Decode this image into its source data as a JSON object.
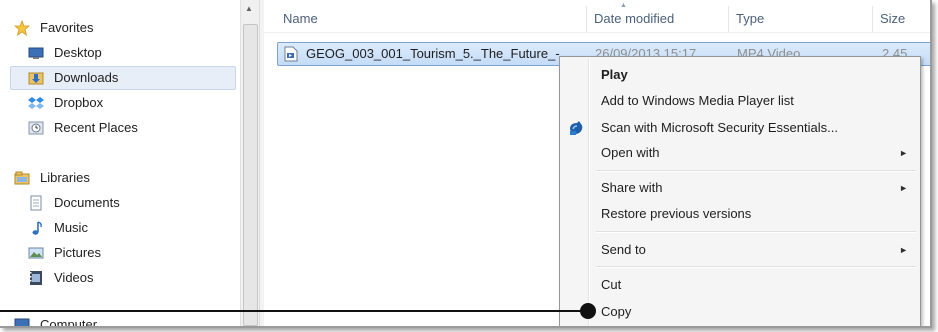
{
  "nav": {
    "favorites": {
      "label": "Favorites",
      "icon": "star-icon"
    },
    "favorite_items": [
      {
        "label": "Desktop",
        "icon": "desktop-icon"
      },
      {
        "label": "Downloads",
        "icon": "downloads-folder-icon",
        "selected": true
      },
      {
        "label": "Dropbox",
        "icon": "dropbox-icon"
      },
      {
        "label": "Recent Places",
        "icon": "recent-places-icon"
      }
    ],
    "libraries": {
      "label": "Libraries",
      "icon": "libraries-icon"
    },
    "library_items": [
      {
        "label": "Documents",
        "icon": "documents-icon"
      },
      {
        "label": "Music",
        "icon": "music-icon"
      },
      {
        "label": "Pictures",
        "icon": "pictures-icon"
      },
      {
        "label": "Videos",
        "icon": "videos-icon"
      }
    ],
    "computer": {
      "label": "Computer",
      "icon": "computer-icon"
    }
  },
  "columns": {
    "name": "Name",
    "date": "Date modified",
    "type": "Type",
    "size": "Size"
  },
  "file": {
    "name": "GEOG_003_001_Tourism_5._The_Future_-...",
    "date": "26/09/2013 15:17",
    "type": "MP4 Video",
    "size": "2,45"
  },
  "menu": {
    "play": "Play",
    "add_wmp": "Add to Windows Media Player list",
    "scan": "Scan with Microsoft Security Essentials...",
    "open_with": "Open with",
    "share_with": "Share with",
    "restore": "Restore previous versions",
    "send_to": "Send to",
    "cut": "Cut",
    "copy": "Copy",
    "submenu_arrow": "►"
  },
  "colors": {
    "selection": "#c4dcf7",
    "header_text": "#4c607a",
    "accent": "#1f5fa8"
  }
}
